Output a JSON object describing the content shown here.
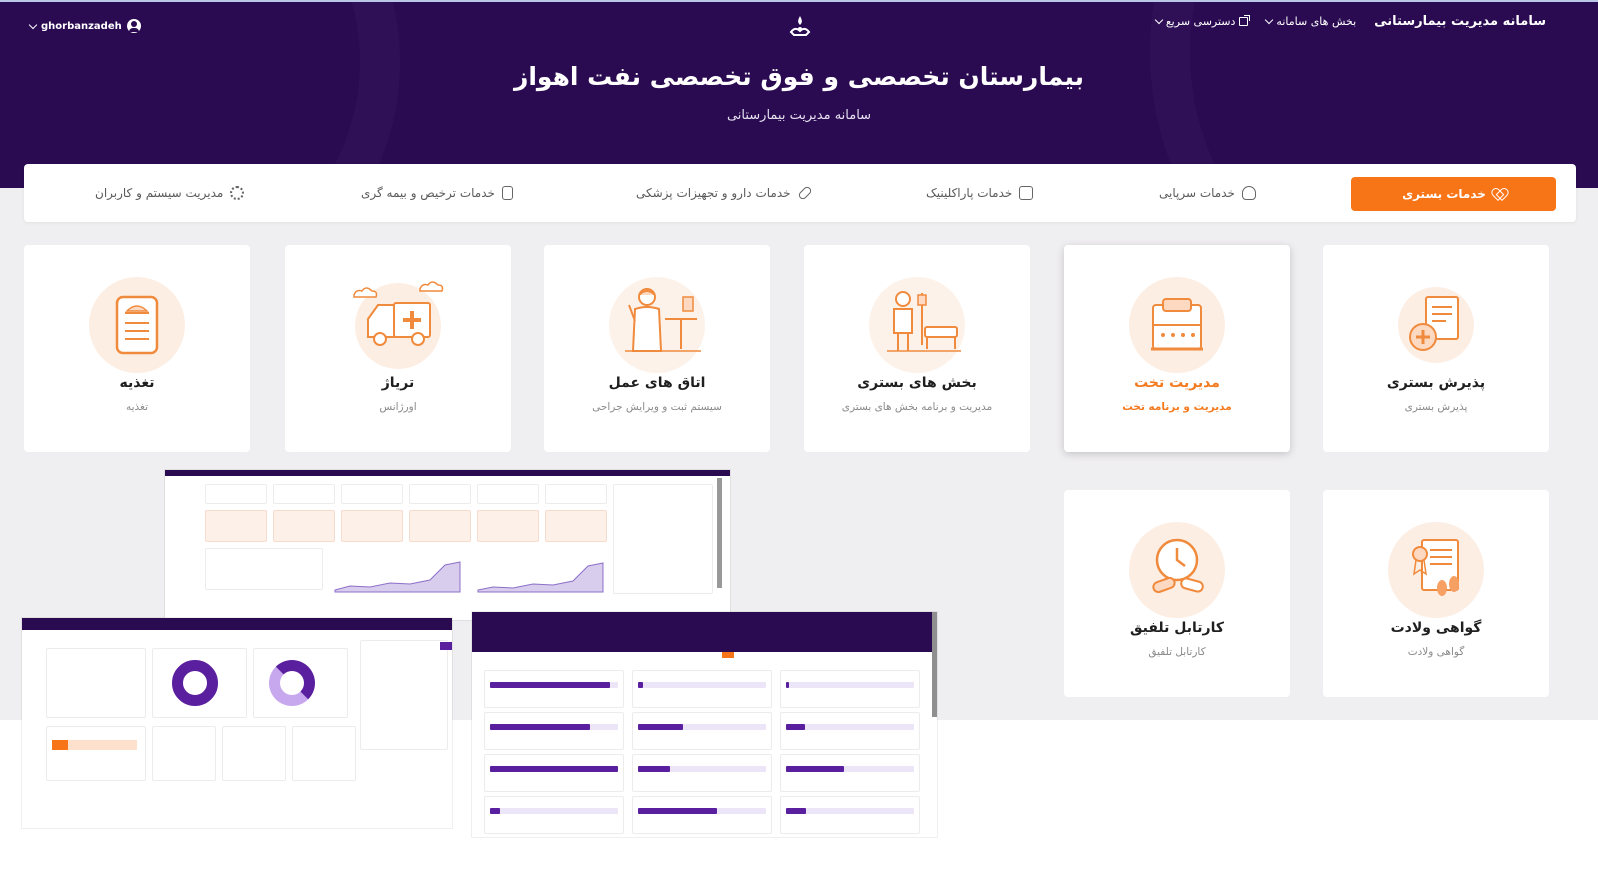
{
  "header": {
    "user_name": "ghorbanzadeh",
    "brand": "سامانه مدیریت بیمارستانی",
    "nav_sections": "بخش های سامانه",
    "nav_quick_access": "دسترسی سریع",
    "hospital_title": "بیمارستان تخصصی و فوق تخصصی نفت اهواز",
    "hospital_subtitle": "سامانه مدیریت بیمارستانی"
  },
  "service_tabs": {
    "inpatient": "خدمات بستری",
    "outpatient": "خدمات سرپایی",
    "paraclinic": "خدمات پاراکلینیک",
    "pharmacy": "خدمات دارو و تجهیزات پزشکی",
    "discharge": "خدمات ترخیص و بیمه گری",
    "system": "مدیریت سیستم و کاربران"
  },
  "modules": {
    "admission": {
      "title": "پذیرش بستری",
      "subtitle": "پذیرش بستری",
      "icon": "admission-document-icon"
    },
    "bed": {
      "title": "مدیریت تخت",
      "subtitle": "مدیریت و برنامه تخت",
      "icon": "hospital-bed-icon"
    },
    "wards": {
      "title": "بخش های بستری",
      "subtitle": "مدیریت و برنامه بخش های بستری",
      "icon": "ward-patient-icon"
    },
    "or": {
      "title": "اتاق های عمل",
      "subtitle": "سیستم ثبت و ویرایش جراحی",
      "icon": "surgeon-icon"
    },
    "triage": {
      "title": "ترياژ",
      "subtitle": "اورژانس",
      "icon": "ambulance-icon"
    },
    "nutrition": {
      "title": "تغذیه",
      "subtitle": "تغذیه",
      "icon": "food-menu-icon"
    },
    "birth": {
      "title": "گواهی ولادت",
      "subtitle": "گواهی ولادت",
      "icon": "birth-certificate-icon"
    },
    "kartable": {
      "title": "کارتابل تلفیق",
      "subtitle": "کارتابل تلفیق",
      "icon": "clock-pills-icon"
    }
  },
  "colors": {
    "header_bg": "#2a0b52",
    "accent_orange": "#f77417",
    "card_circle": "#fdeee4",
    "page_bg": "#efeef0"
  }
}
